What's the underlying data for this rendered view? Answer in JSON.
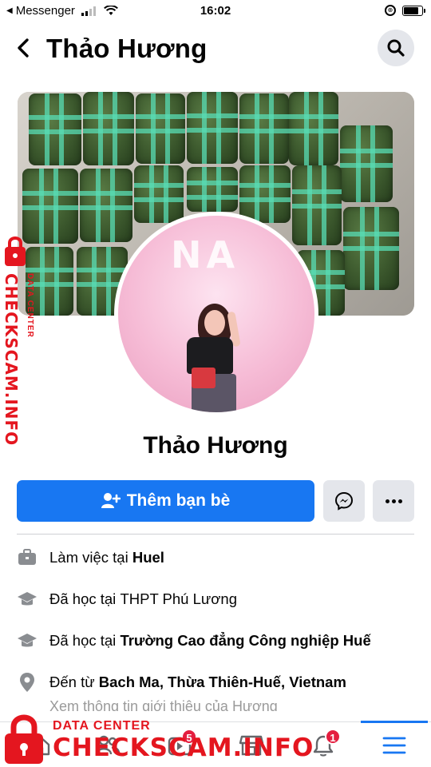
{
  "status_bar": {
    "back_app": "Messenger",
    "time": "16:02",
    "battery_level": 0.8
  },
  "header": {
    "title": "Thảo Hương",
    "back_icon": "chevron-left-icon",
    "search_icon": "search-icon"
  },
  "profile": {
    "name": "Thảo Hương",
    "cover_neon_text": "NA"
  },
  "actions": {
    "add_friend_label": "Thêm bạn bè",
    "add_friend_icon": "add-person-icon",
    "messenger_icon": "messenger-icon",
    "more_icon": "more-dots-icon"
  },
  "intro": {
    "work_prefix": "Làm việc tại ",
    "work_place": "Huel",
    "studied_1_prefix": "Đã học tại ",
    "studied_1_place": "THPT Phú Lương",
    "studied_2_prefix": "Đã học tại ",
    "studied_2_place": "Trường Cao đẳng Công nghiệp Huế",
    "from_prefix": "Đến từ ",
    "from_place": "Bach Ma, Thừa Thiên-Huế, Vietnam",
    "cut_off_text": "Xem thông tin giới thiệu của Hương"
  },
  "bottom_nav": {
    "items": [
      {
        "icon": "home-icon"
      },
      {
        "icon": "friends-icon"
      },
      {
        "icon": "watch-icon",
        "badge": "5"
      },
      {
        "icon": "marketplace-icon"
      },
      {
        "icon": "bell-icon",
        "badge": "1"
      },
      {
        "icon": "menu-icon",
        "active": true
      }
    ]
  },
  "watermark": {
    "small": "DATA CENTER",
    "big": "CHECKSCAM.INFO"
  },
  "colors": {
    "primary": "#1877f2",
    "button_gray": "#e4e6eb",
    "badge_red": "#e41e3f",
    "watermark_red": "#e4161f"
  }
}
